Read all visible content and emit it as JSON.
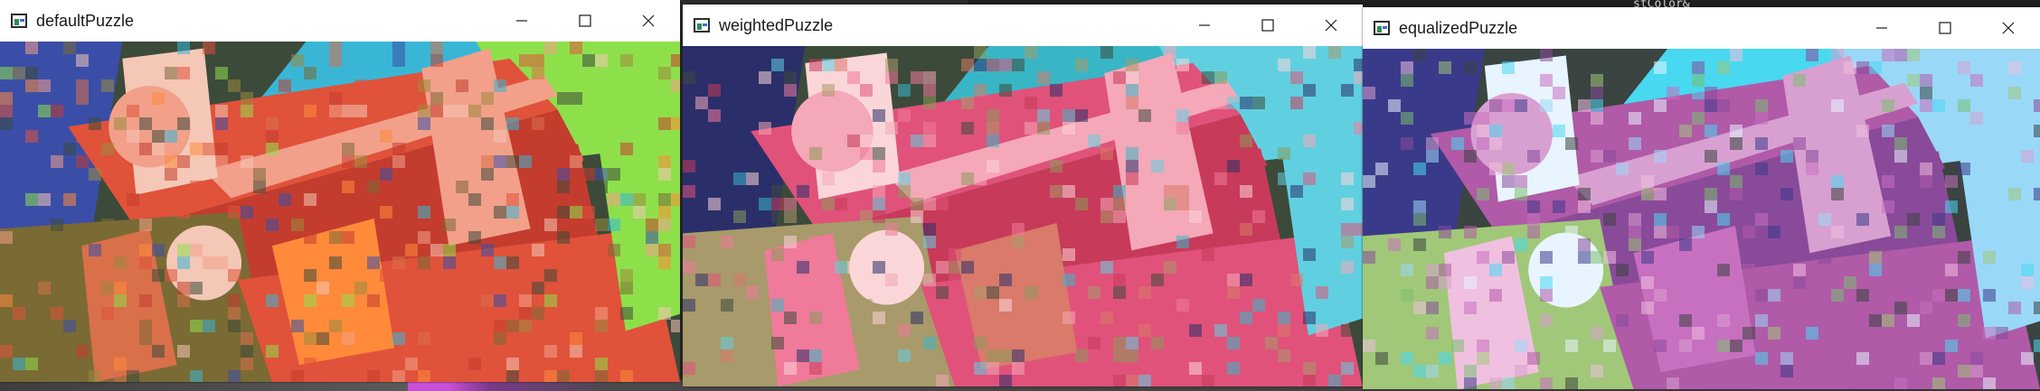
{
  "background": {
    "code_snippet": "stColor&"
  },
  "windows": [
    {
      "title": "defaultPuzzle",
      "palette": [
        "#e0523a",
        "#c43c2e",
        "#f2a08a",
        "#f4c7b6",
        "#9b8a3e",
        "#3c4a3a",
        "#39b6d6",
        "#8ee04a",
        "#ff8a3a",
        "#3a4ea8",
        "#7a6a34",
        "#d9704a"
      ],
      "controls": [
        "minimize",
        "maximize",
        "close"
      ]
    },
    {
      "title": "weightedPuzzle",
      "palette": [
        "#e0527a",
        "#c83a5a",
        "#f4a8b8",
        "#fbd6d8",
        "#8a9a5a",
        "#3c4a3a",
        "#39b6c6",
        "#60d0e0",
        "#d97a6a",
        "#2a2f6a",
        "#a89a6a",
        "#f07a9a"
      ],
      "controls": [
        "minimize",
        "maximize",
        "close"
      ]
    },
    {
      "title": "equalizedPuzzle",
      "palette": [
        "#b05aa8",
        "#8a4a9a",
        "#d8a0d0",
        "#e8f4ff",
        "#7ac070",
        "#3a4440",
        "#48d8f0",
        "#9ad8f8",
        "#c870c0",
        "#3a3a8a",
        "#a0c878",
        "#f0c0e0"
      ],
      "controls": [
        "minimize",
        "maximize",
        "close"
      ]
    }
  ]
}
